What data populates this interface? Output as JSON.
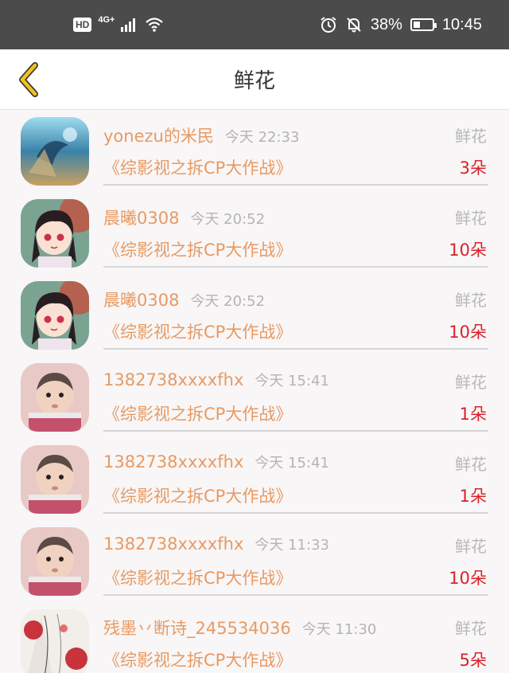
{
  "status_bar": {
    "hd": "HD",
    "network": "4G+",
    "battery": "38%",
    "time": "10:45"
  },
  "header": {
    "title": "鲜花"
  },
  "gift_list": [
    {
      "name": "yonezu的米民",
      "time": "今天 22:33",
      "type": "鲜花",
      "work": "《综影视之拆CP大作战》",
      "count": "3朵",
      "avatar": "avatar-fantasy-blue"
    },
    {
      "name": "晨曦0308",
      "time": "今天 20:52",
      "type": "鲜花",
      "work": "《综影视之拆CP大作战》",
      "count": "10朵",
      "avatar": "avatar-anime-girl"
    },
    {
      "name": "晨曦0308",
      "time": "今天 20:52",
      "type": "鲜花",
      "work": "《综影视之拆CP大作战》",
      "count": "10朵",
      "avatar": "avatar-anime-girl"
    },
    {
      "name": "1382738xxxxfhx",
      "time": "今天 15:41",
      "type": "鲜花",
      "work": "《综影视之拆CP大作战》",
      "count": "1朵",
      "avatar": "avatar-baby"
    },
    {
      "name": "1382738xxxxfhx",
      "time": "今天 15:41",
      "type": "鲜花",
      "work": "《综影视之拆CP大作战》",
      "count": "1朵",
      "avatar": "avatar-baby"
    },
    {
      "name": "1382738xxxxfhx",
      "time": "今天 11:33",
      "type": "鲜花",
      "work": "《综影视之拆CP大作战》",
      "count": "10朵",
      "avatar": "avatar-baby"
    },
    {
      "name": "残墨丷断诗_245534036",
      "time": "今天 11:30",
      "type": "鲜花",
      "work": "《综影视之拆CP大作战》",
      "count": "5朵",
      "avatar": "avatar-ink-red"
    }
  ],
  "colors": {
    "name_orange": "#e89a62",
    "count_red": "#d8232a",
    "back_arrow_yellow": "#f2c21a"
  }
}
